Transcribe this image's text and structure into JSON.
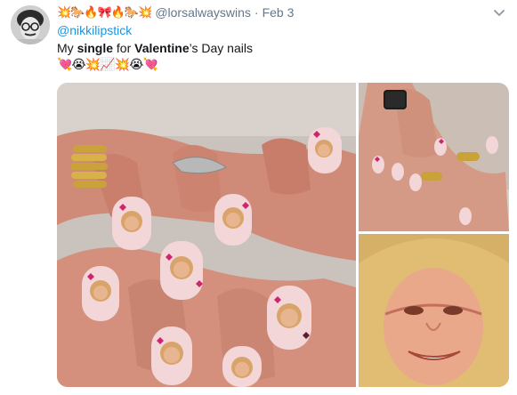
{
  "tweet": {
    "display_name_emoji": "💥🐎🔥🎀🔥🐎💥",
    "handle": "@lorsalwayswins",
    "separator": "·",
    "time": "Feb 3",
    "mention": "@nikkilipstick",
    "text_parts": [
      "My ",
      "single",
      " for ",
      "Valentine",
      "’s Day nails"
    ],
    "emoji_line": "💘😭💥📈💥😭💘"
  },
  "icons": {
    "avatar": "avatar-photo",
    "more": "chevron-down-icon"
  },
  "media": {
    "images": [
      "nail-art-hands-photo",
      "nail-art-ring-photo",
      "crying-face-photo"
    ]
  },
  "colors": {
    "link": "#1b95e0",
    "secondary": "#657786",
    "text": "#14171a"
  }
}
